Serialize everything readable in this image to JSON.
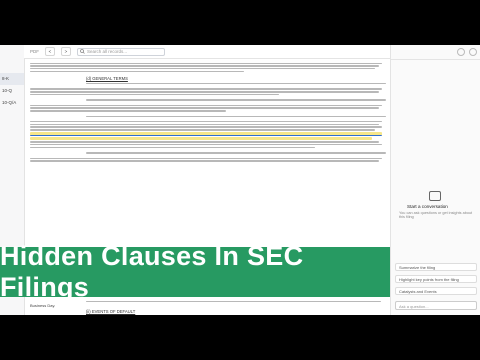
{
  "toolbar": {
    "pdf_label": "PDF",
    "search_placeholder": "Search all records...",
    "page_prev": "<",
    "page_next": ">"
  },
  "rail": {
    "items": [
      "8-K",
      "10-Q",
      "10-Q/A"
    ],
    "active_index": 0
  },
  "document": {
    "heading_1": "(d) GENERAL TERMS",
    "heading_2": "(ii) EVENTS OF DEFAULT",
    "footer_label": "Business Day."
  },
  "banner": {
    "title": "Hidden Clauses In SEC Filings"
  },
  "side_panel": {
    "chat_title": "Start a conversation",
    "chat_subtitle": "You can ask questions or get insights about this filing",
    "suggestions": [
      "Summarize the filing",
      "Highlight key points from the filing",
      "Catalysts and Events"
    ],
    "ask_placeholder": "Ask a question..."
  },
  "colors": {
    "banner": "#279a62",
    "highlight": "#f6e68a",
    "underline": "#2f6fd1"
  }
}
